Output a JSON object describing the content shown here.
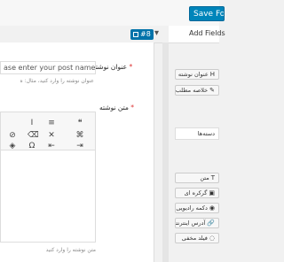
{
  "header": {
    "save_label": "Save Form"
  },
  "builder": {
    "badge_label": "#8",
    "chevron": "chevron-down-icon"
  },
  "sidebar": {
    "title": "Add Fields",
    "fields_group1": [
      {
        "label": "عنوان نوشته",
        "icon": "H"
      },
      {
        "label": "خلاصه مطلب",
        "icon": "✎"
      }
    ],
    "section2": "دسته‌ها",
    "fields_group3": [
      {
        "label": "متن",
        "icon": "T"
      },
      {
        "label": "گرکره ای",
        "icon": "▣"
      },
      {
        "label": "دکمه رادیویی",
        "icon": "◉"
      },
      {
        "label": "آدرس اینترنتی",
        "icon": "🔗"
      },
      {
        "label": "فیلد مخفی",
        "icon": "◌"
      }
    ]
  },
  "form": {
    "title_label": "عنوان نوشته",
    "title_required": "*",
    "title_placeholder": "ase enter your post name",
    "title_hint": "عنوان نوشته را وارد کنید، مثال: ه",
    "content_label": "متن نوشته",
    "content_required": "*",
    "content_hint": "متن نوشته را وارد کنید"
  },
  "toolbar": {
    "row1": [
      "I",
      "≡",
      "❝"
    ],
    "row2": [
      "⊘",
      "⌫",
      "✕",
      "⌘"
    ],
    "row3": [
      "◈",
      "Ω",
      "⇤",
      "⇥"
    ]
  }
}
